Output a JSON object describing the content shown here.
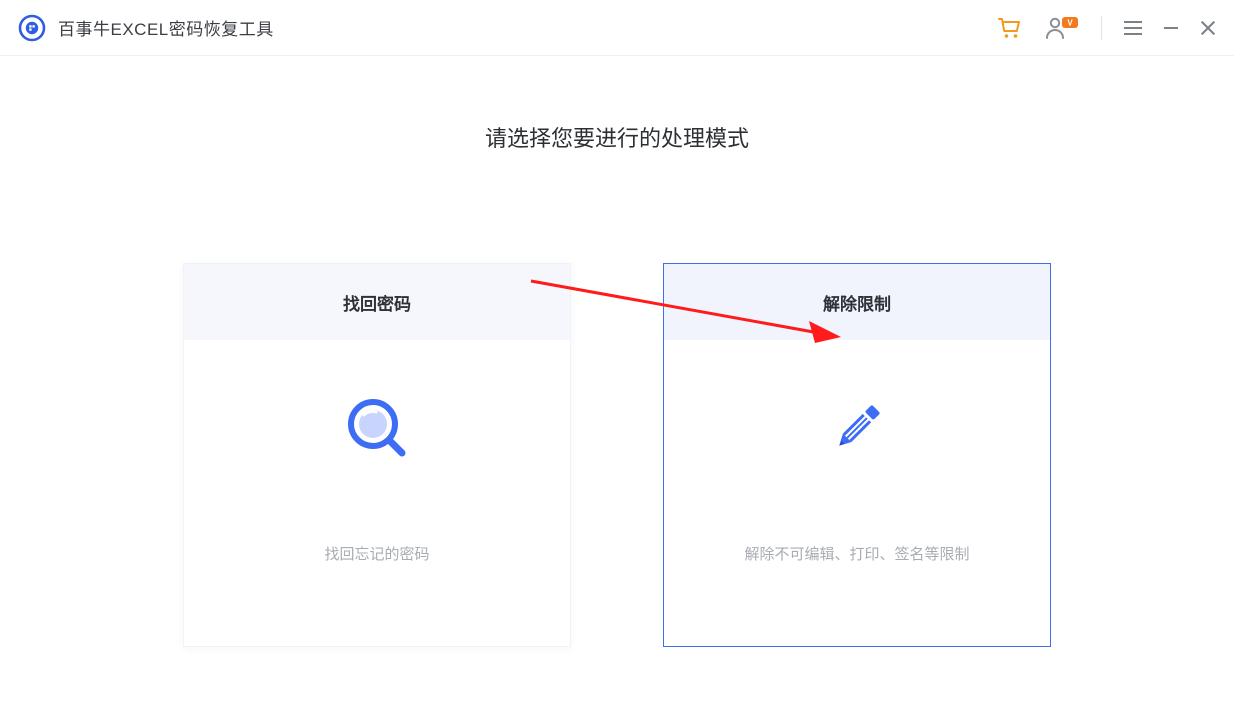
{
  "app": {
    "title": "百事牛EXCEL密码恢复工具"
  },
  "header": {
    "cart_icon": "shopping-cart",
    "account_icon": "account-vip",
    "menu_icon": "menu",
    "minimize_icon": "minimize",
    "close_icon": "close"
  },
  "main": {
    "heading": "请选择您要进行的处理模式",
    "cards": [
      {
        "title": "找回密码",
        "description": "找回忘记的密码",
        "icon": "magnifier",
        "selected": false
      },
      {
        "title": "解除限制",
        "description": "解除不可编辑、打印、签名等限制",
        "icon": "pencil",
        "selected": true
      }
    ]
  },
  "annotation": {
    "type": "arrow",
    "color": "#ff1b1b"
  }
}
